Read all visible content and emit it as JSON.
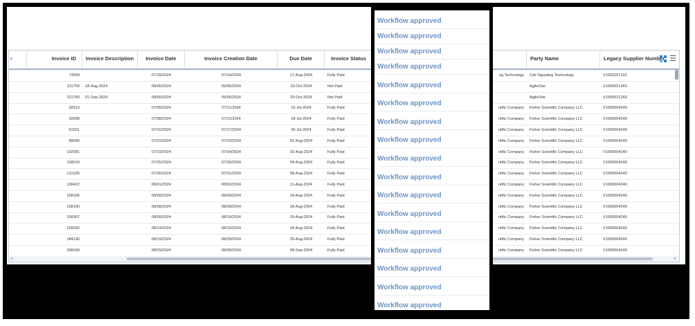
{
  "grid": {
    "columns": {
      "first_partial": "r",
      "invoice_id": "Invoice ID",
      "invoice_description": "Invoice Description",
      "invoice_date": "Invoice Date",
      "invoice_creation_date": "Invoice Creation Date",
      "due_date": "Due Date",
      "invoice_status": "Invoice Status",
      "party_name": "Party Name",
      "legacy_supplier_number": "Legacy Supplier Number"
    },
    "rows": [
      {
        "id": "73009",
        "desc": "",
        "inv_date": "07/18/2024",
        "created": "07/19/2024",
        "due": "17-Aug-2024",
        "status": "Fully Paid",
        "supplier_partial": "ng Technology",
        "party": "Cell Signaling Technology",
        "legacy": "V1002297110"
      },
      {
        "id": "211759",
        "desc": "18-Aug-2024",
        "inv_date": "09/05/2024",
        "created": "09/05/2024",
        "due": "20-Oct-2024",
        "status": "Not Paid",
        "supplier_partial": "",
        "party": "AgileOne",
        "legacy": "V1005021260"
      },
      {
        "id": "211760",
        "desc": "01-Sep-2024",
        "inv_date": "09/05/2024",
        "created": "09/05/2024",
        "due": "20-Oct-2024",
        "status": "Not Paid",
        "supplier_partial": "",
        "party": "AgileOne",
        "legacy": "V1005021260"
      },
      {
        "id": "32013",
        "desc": "",
        "inv_date": "07/05/2024",
        "created": "07/11/2024",
        "due": "15-Jul-2024",
        "status": "Fully Paid",
        "supplier_partial": "ntific Company",
        "party": "Fisher Scientific Company LLC",
        "legacy": "V1000004240"
      },
      {
        "id": "32008",
        "desc": "",
        "inv_date": "07/08/2024",
        "created": "07/11/2024",
        "due": "18-Jul-2024",
        "status": "Fully Paid",
        "supplier_partial": "ntific Company",
        "party": "Fisher Scientific Company LLC",
        "legacy": "V1000004240"
      },
      {
        "id": "61031",
        "desc": "",
        "inv_date": "07/16/2024",
        "created": "07/17/2024",
        "due": "26-Jul-2024",
        "status": "Fully Paid",
        "supplier_partial": "ntific Company",
        "party": "Fisher Scientific Company LLC",
        "legacy": "V1000004240"
      },
      {
        "id": "89045",
        "desc": "",
        "inv_date": "07/22/2024",
        "created": "07/23/2024",
        "due": "01-Aug-2024",
        "status": "Fully Paid",
        "supplier_partial": "ntific Company",
        "party": "Fisher Scientific Company LLC",
        "legacy": "V1000004240"
      },
      {
        "id": "102091",
        "desc": "",
        "inv_date": "07/23/2024",
        "created": "07/24/2024",
        "due": "02-Aug-2024",
        "status": "Fully Paid",
        "supplier_partial": "ntific Company",
        "party": "Fisher Scientific Company LLC",
        "legacy": "V1000004240"
      },
      {
        "id": "118019",
        "desc": "",
        "inv_date": "07/25/2024",
        "created": "07/26/2024",
        "due": "04-Aug-2024",
        "status": "Fully Paid",
        "supplier_partial": "ntific Company",
        "party": "Fisher Scientific Company LLC",
        "legacy": "V1000004240"
      },
      {
        "id": "131205",
        "desc": "",
        "inv_date": "07/30/2024",
        "created": "07/31/2024",
        "due": "09-Aug-2024",
        "status": "Fully Paid",
        "supplier_partial": "ntific Company",
        "party": "Fisher Scientific Company LLC",
        "legacy": "V1000004240"
      },
      {
        "id": "136422",
        "desc": "",
        "inv_date": "08/01/2024",
        "created": "08/02/2024",
        "due": "11-Aug-2024",
        "status": "Fully Paid",
        "supplier_partial": "ntific Company",
        "party": "Fisher Scientific Company LLC",
        "legacy": "V1000004240"
      },
      {
        "id": "158106",
        "desc": "",
        "inv_date": "08/08/2024",
        "created": "08/09/2024",
        "due": "18-Aug-2024",
        "status": "Fully Paid",
        "supplier_partial": "ntific Company",
        "party": "Fisher Scientific Company LLC",
        "legacy": "V1000004240"
      },
      {
        "id": "158100",
        "desc": "",
        "inv_date": "08/08/2024",
        "created": "08/09/2024",
        "due": "18-Aug-2024",
        "status": "Fully Paid",
        "supplier_partial": "ntific Company",
        "party": "Fisher Scientific Company LLC",
        "legacy": "V1000004240"
      },
      {
        "id": "158307",
        "desc": "",
        "inv_date": "08/09/2024",
        "created": "08/10/2024",
        "due": "19-Aug-2024",
        "status": "Fully Paid",
        "supplier_partial": "ntific Company",
        "party": "Fisher Scientific Company LLC",
        "legacy": "V1000004240"
      },
      {
        "id": "169202",
        "desc": "",
        "inv_date": "08/14/2024",
        "created": "08/15/2024",
        "due": "24-Aug-2024",
        "status": "Fully Paid",
        "supplier_partial": "ntific Company",
        "party": "Fisher Scientific Company LLC",
        "legacy": "V1000004240"
      },
      {
        "id": "184136",
        "desc": "",
        "inv_date": "08/19/2024",
        "created": "08/20/2024",
        "due": "29-Aug-2024",
        "status": "Fully Paid",
        "supplier_partial": "ntific Company",
        "party": "Fisher Scientific Company LLC",
        "legacy": "V1000004240"
      },
      {
        "id": "208169",
        "desc": "",
        "inv_date": "08/29/2024",
        "created": "08/30/2024",
        "due": "08-Sep-2024",
        "status": "Fully Paid",
        "supplier_partial": "ntific Company",
        "party": "Fisher Scientific Company LLC",
        "legacy": "V1000004240"
      }
    ]
  },
  "popup": {
    "items": [
      "Workflow approved",
      "Workflow approved",
      "Workflow approved",
      "Workflow approved",
      "Workflow approved",
      "Workflow approved",
      "Workflow approved",
      "Workflow approved",
      "Workflow approved",
      "Workflow approved",
      "Workflow approved",
      "Workflow approved",
      "Workflow approved",
      "Workflow approved",
      "Workflow approved",
      "Workflow approved",
      "Workflow approved"
    ]
  },
  "icons": {
    "menu": "hamburger-menu-icon",
    "columns": "column-chooser-icon"
  },
  "colors": {
    "workflow_text": "#6b93c4",
    "header_border": "#9fb3c7"
  }
}
